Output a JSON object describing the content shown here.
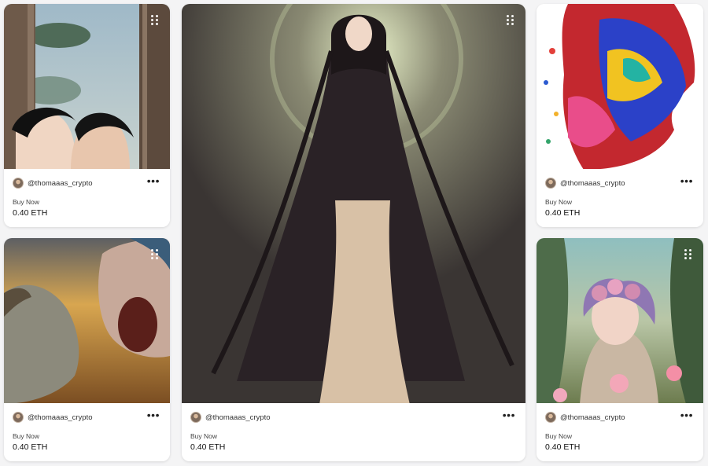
{
  "cards": [
    {
      "owner": "@thomaaas_crypto",
      "status": "Buy Now",
      "price": "0.40 ETH",
      "art": "anime couple near window"
    },
    {
      "owner": "@thomaaas_crypto",
      "status": "Buy Now",
      "price": "0.40 ETH",
      "art": "long-haired woman in dark cloak"
    },
    {
      "owner": "@thomaaas_crypto",
      "status": "Buy Now",
      "price": "0.40 ETH",
      "art": "colorful abstract face"
    },
    {
      "owner": "@thomaaas_crypto",
      "status": "Buy Now",
      "price": "0.40 ETH",
      "art": "stone face and screaming mask"
    },
    {
      "owner": "@thomaaas_crypto",
      "status": "Buy Now",
      "price": "0.40 ETH",
      "art": "woman with flower crown"
    }
  ],
  "icons": {
    "more": "more-horizontal-icon",
    "drag": "drag-handle-icon",
    "avatar": "avatar"
  }
}
